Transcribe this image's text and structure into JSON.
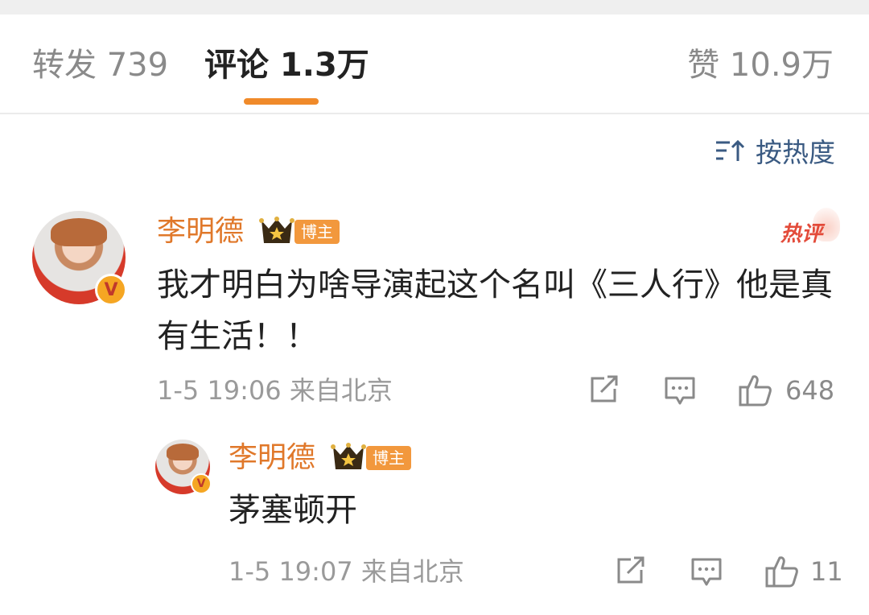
{
  "tabs": {
    "repost_label": "转发 739",
    "comments_label": "评论 1.3万",
    "likes_label": "赞 10.9万"
  },
  "sort": {
    "label": "按热度",
    "icon": "sort-icon"
  },
  "comments": [
    {
      "username": "李明德",
      "badge": "博主",
      "hot_tag": "热评",
      "text": "我才明白为啥导演起这个名叫《三人行》他是真有生活！！",
      "meta": "1-5 19:06 来自北京",
      "likes": "648"
    },
    {
      "username": "李明德",
      "badge": "博主",
      "text": "茅塞顿开",
      "meta": "1-5 19:07 来自北京",
      "likes": "11"
    }
  ],
  "colors": {
    "accent": "#f08a2a",
    "username": "#e0782a",
    "badge": "#f2983d",
    "sort_text": "#3a5a82",
    "hot_tag": "#e34b3a"
  }
}
